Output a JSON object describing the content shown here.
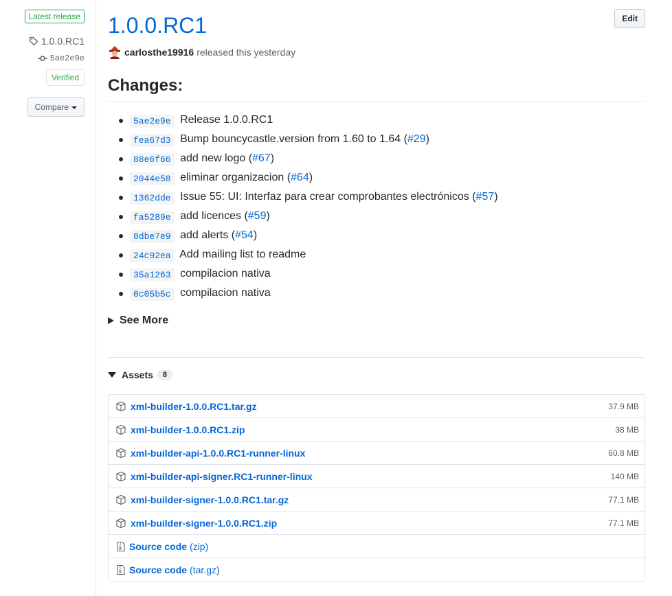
{
  "sidebar": {
    "latest_badge": "Latest release",
    "tag": "1.0.0.RC1",
    "commit": "5ae2e9e",
    "verified": "Verified",
    "compare_label": "Compare"
  },
  "release": {
    "title": "1.0.0.RC1",
    "edit_label": "Edit",
    "author": "carlosthe19916",
    "released_text": "released this yesterday"
  },
  "changes": {
    "heading": "Changes:",
    "items": [
      {
        "sha": "5ae2e9e",
        "text": "Release 1.0.0.RC1",
        "pr": "",
        "suffix": ""
      },
      {
        "sha": "fea67d3",
        "text": "Bump bouncycastle.version from 1.60 to 1.64 (",
        "pr": "#29",
        "suffix": ")"
      },
      {
        "sha": "88e6f66",
        "text": "add new logo (",
        "pr": "#67",
        "suffix": ")"
      },
      {
        "sha": "2044e58",
        "text": "eliminar organizacion (",
        "pr": "#64",
        "suffix": ")"
      },
      {
        "sha": "1362dde",
        "text": "Issue 55: UI: Interfaz para crear comprobantes electrónicos (",
        "pr": "#57",
        "suffix": ")"
      },
      {
        "sha": "fa5289e",
        "text": "add licences (",
        "pr": "#59",
        "suffix": ")"
      },
      {
        "sha": "8dbe7e9",
        "text": "add alerts (",
        "pr": "#54",
        "suffix": ")"
      },
      {
        "sha": "24c92ea",
        "text": "Add mailing list to readme",
        "pr": "",
        "suffix": ""
      },
      {
        "sha": "35a1263",
        "text": "compilacion nativa",
        "pr": "",
        "suffix": ""
      },
      {
        "sha": "0c05b5c",
        "text": "compilacion nativa",
        "pr": "",
        "suffix": ""
      }
    ],
    "see_more": "See More"
  },
  "assets": {
    "label": "Assets",
    "count": "8",
    "files": [
      {
        "name": "xml-builder-1.0.0.RC1.tar.gz",
        "size": "37.9 MB"
      },
      {
        "name": "xml-builder-1.0.0.RC1.zip",
        "size": "38 MB"
      },
      {
        "name": "xml-builder-api-1.0.0.RC1-runner-linux",
        "size": "60.8 MB"
      },
      {
        "name": "xml-builder-api-signer.RC1-runner-linux",
        "size": "140 MB"
      },
      {
        "name": "xml-builder-signer-1.0.0.RC1.tar.gz",
        "size": "77.1 MB"
      },
      {
        "name": "xml-builder-signer-1.0.0.RC1.zip",
        "size": "77.1 MB"
      }
    ],
    "sources": [
      {
        "name": "Source code",
        "suffix": "(zip)"
      },
      {
        "name": "Source code",
        "suffix": "(tar.gz)"
      }
    ]
  },
  "icons": {
    "tag": "tag-icon",
    "commit": "git-commit-icon",
    "package": "package-icon",
    "archive": "file-zip-icon"
  },
  "colors": {
    "link": "#0366d6",
    "verified": "#28a745",
    "muted": "#586069",
    "text": "#24292e"
  }
}
